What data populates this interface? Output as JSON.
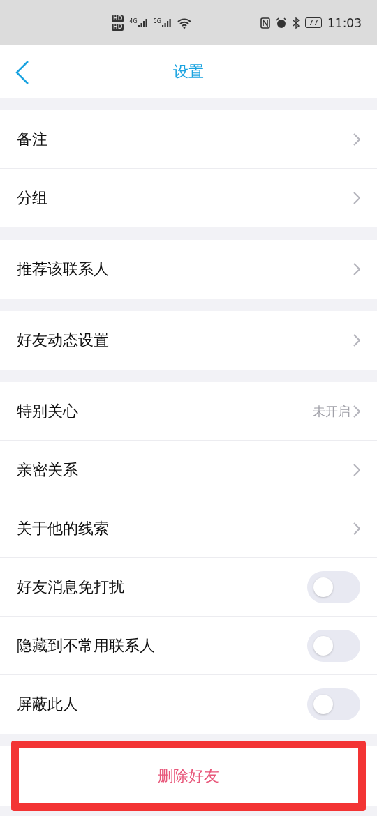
{
  "status_bar": {
    "sim_labels": [
      "HD",
      "HD"
    ],
    "networks": [
      "4G",
      "5G"
    ],
    "battery": "77",
    "time": "11:03"
  },
  "header": {
    "title": "设置"
  },
  "groups": [
    {
      "rows": [
        {
          "kind": "link",
          "label": "备注"
        },
        {
          "kind": "link",
          "label": "分组"
        }
      ]
    },
    {
      "rows": [
        {
          "kind": "link",
          "label": "推荐该联系人"
        }
      ]
    },
    {
      "rows": [
        {
          "kind": "link",
          "label": "好友动态设置"
        }
      ]
    },
    {
      "rows": [
        {
          "kind": "link",
          "label": "特别关心",
          "value": "未开启"
        },
        {
          "kind": "link",
          "label": "亲密关系"
        },
        {
          "kind": "link",
          "label": "关于他的线索"
        },
        {
          "kind": "toggle",
          "label": "好友消息免打扰",
          "on": false
        },
        {
          "kind": "toggle",
          "label": "隐藏到不常用联系人",
          "on": false
        },
        {
          "kind": "toggle",
          "label": "屏蔽此人",
          "on": false
        }
      ]
    }
  ],
  "delete_button": {
    "label": "删除好友",
    "highlighted": true
  }
}
